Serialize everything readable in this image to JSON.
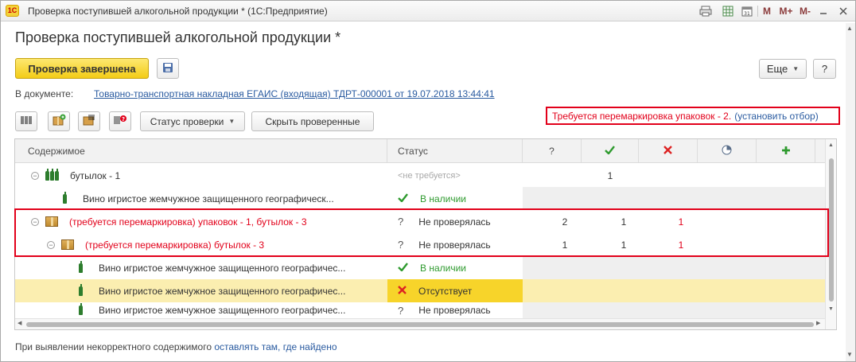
{
  "window": {
    "title": "Проверка поступившей алкогольной продукции * (1С:Предприятие)",
    "logo_text": "1С",
    "mem_buttons": [
      "M",
      "M+",
      "M-"
    ]
  },
  "form": {
    "title": "Проверка поступившей алкогольной продукции *",
    "done_button": "Проверка завершена",
    "more_button": "Еще",
    "help_button": "?",
    "doc_label": "В документе:",
    "doc_link": "Товарно-транспортная накладная ЕГАИС (входящая) ТДРТ-000001 от 19.07.2018 13:44:41"
  },
  "toolbar": {
    "status_check_button": "Статус проверки",
    "hide_checked_button": "Скрыть проверенные"
  },
  "warning": {
    "text": "Требуется перемаркировка упаковок - 2.",
    "link": "(установить отбор)"
  },
  "table": {
    "headers": {
      "content": "Содержимое",
      "status": "Статус",
      "q": "?"
    },
    "rows": [
      {
        "content": "бутылок -  1",
        "status": "<не требуется>",
        "c_q": "",
        "c_ok": "1",
        "c_x": ""
      },
      {
        "content": "Вино игристое жемчужное защищенного географическ...",
        "status": "В наличии",
        "c_q": "",
        "c_ok": "",
        "c_x": ""
      },
      {
        "content": "(требуется перемаркировка) упаковок - 1, бутылок -  3",
        "status": "Не проверялась",
        "c_q": "2",
        "c_ok": "1",
        "c_x": "1"
      },
      {
        "content": "(требуется перемаркировка) бутылок -  3",
        "status": "Не проверялась",
        "c_q": "1",
        "c_ok": "1",
        "c_x": "1"
      },
      {
        "content": "Вино игристое жемчужное защищенного географичес...",
        "status": "В наличии",
        "c_q": "",
        "c_ok": "",
        "c_x": ""
      },
      {
        "content": "Вино игристое жемчужное защищенного географичес...",
        "status": "Отсутствует",
        "c_q": "",
        "c_ok": "",
        "c_x": ""
      },
      {
        "content": "Вино игристое жемчужное защищенного географичес...",
        "status": "Не проверялась",
        "c_q": "",
        "c_ok": "",
        "c_x": ""
      }
    ]
  },
  "footer": {
    "text": "При выявлении некорректного содержимого",
    "link": "оставлять там, где найдено"
  },
  "colors": {
    "accent_yellow": "#f3cc17",
    "error_red": "#e2001a",
    "link_blue": "#2a5ba0",
    "ok_green": "#2e9a2e"
  }
}
